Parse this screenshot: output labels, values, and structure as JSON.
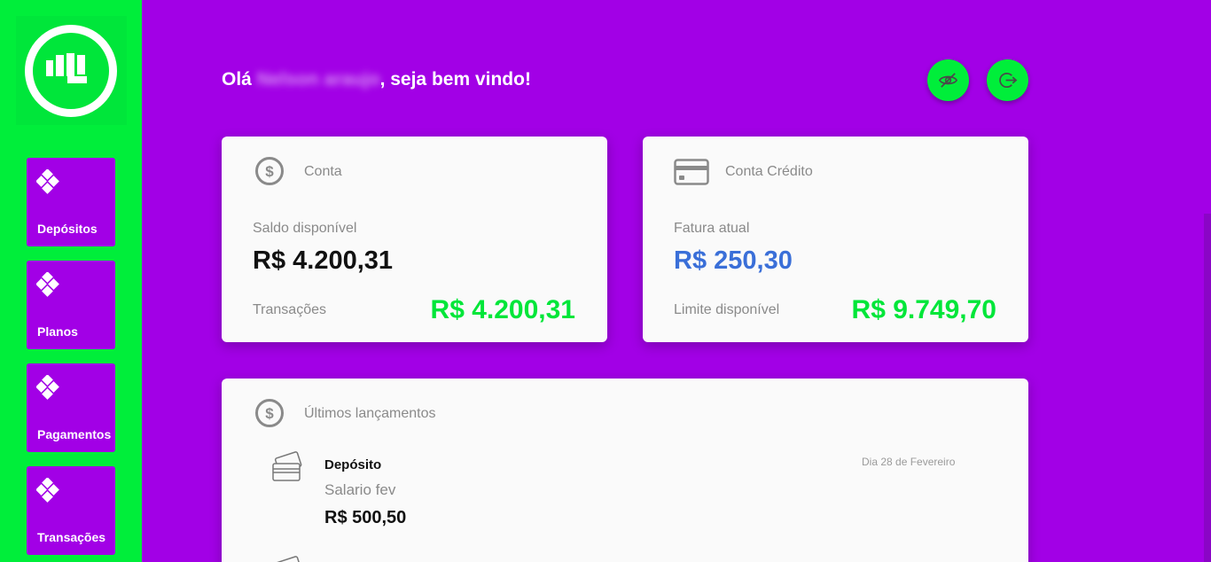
{
  "sidebar": {
    "logo": "fist-logo-icon",
    "items": [
      {
        "label": "Depósitos",
        "icon": "pix-diamond-icon"
      },
      {
        "label": "Planos",
        "icon": "pix-diamond-icon"
      },
      {
        "label": "Pagamentos",
        "icon": "pix-diamond-icon"
      },
      {
        "label": "Transações",
        "icon": "pix-diamond-icon"
      }
    ]
  },
  "header": {
    "greeting_prefix": "Olá ",
    "user_name": "Nelson araujo",
    "greeting_suffix": ", seja bem vindo!",
    "hide_values_icon": "eye-off-icon",
    "logout_icon": "logout-icon"
  },
  "account_card": {
    "title": "Conta",
    "icon": "dollar-circle-icon",
    "balance_label": "Saldo disponível",
    "balance_value": "R$ 4.200,31",
    "transactions_label": "Transações",
    "transactions_value": "R$ 4.200,31"
  },
  "credit_card": {
    "title": "Conta Crédito",
    "icon": "credit-card-icon",
    "invoice_label": "Fatura atual",
    "invoice_value": "R$ 250,30",
    "limit_label": "Limite disponível",
    "limit_value": "R$ 9.749,70"
  },
  "recent": {
    "title": "Últimos lançamentos",
    "icon": "dollar-circle-icon",
    "entries": [
      {
        "type": "Depósito",
        "description": "Salario fev",
        "amount": "R$ 500,50",
        "date": "Dia 28 de Fevereiro",
        "icon": "cards-icon"
      }
    ]
  },
  "colors": {
    "background": "#a200e6",
    "sidebar": "#00ee3a",
    "accent_green": "#00e639",
    "accent_blue": "#3a6fd8"
  }
}
